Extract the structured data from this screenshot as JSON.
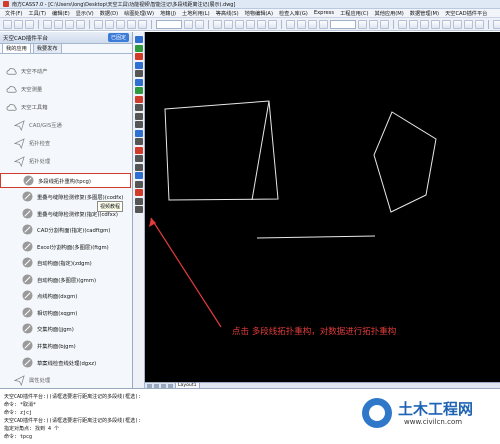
{
  "window": {
    "title": "南方CASS7.0 - [C:\\Users\\long\\Desktop\\天空工具\\功能视频\\智能注记\\多段线距离注记(展示).dwg]"
  },
  "menu": [
    "文件(F)",
    "工具(T)",
    "编辑(E)",
    "显示(V)",
    "数据(D)",
    "绘图处理(W)",
    "地籍(J)",
    "土地利用(L)",
    "等高线(S)",
    "地物编辑(A)",
    "检查入库(G)",
    "Express",
    "工程应用(C)",
    "其他应用(M)",
    "数据管理(M)",
    "天空CAD插件平台"
  ],
  "panel": {
    "title": "天空CAD插件平台",
    "pin_label": "已固定",
    "tabs": [
      "我的应用",
      "我要发布"
    ],
    "items": [
      {
        "label": "天空不动产",
        "kind": "group"
      },
      {
        "label": "天空测量",
        "kind": "group"
      },
      {
        "label": "天空工具箱",
        "kind": "group"
      },
      {
        "label": "CAD/GIS互通",
        "kind": "sub"
      },
      {
        "label": "拓扑检查",
        "kind": "sub"
      },
      {
        "label": "拓扑处理",
        "kind": "sub"
      },
      {
        "label": "多段线拓扑重构(tpcg)",
        "kind": "tool",
        "selected": true
      },
      {
        "label": "重叠与缝隙检测修复(多图层)(codfx)",
        "kind": "tool"
      },
      {
        "label": "重叠与缝隙检测修复(指定)(cdfxx)",
        "kind": "tool"
      },
      {
        "label": "CAD分割构面(指定)(cadftgm)",
        "kind": "tool"
      },
      {
        "label": "Excel分割构面(多图层)(ftgm)",
        "kind": "tool"
      },
      {
        "label": "自动构面(指定)(zdgm)",
        "kind": "tool"
      },
      {
        "label": "自动构面(多图层)(gmm)",
        "kind": "tool"
      },
      {
        "label": "点线构面(dxgm)",
        "kind": "tool"
      },
      {
        "label": "相切构面(xqgm)",
        "kind": "tool"
      },
      {
        "label": "交集构面(jjgm)",
        "kind": "tool"
      },
      {
        "label": "并集构面(bjgm)",
        "kind": "tool"
      },
      {
        "label": "草案线检查线处理(dgxz)",
        "kind": "tool"
      },
      {
        "label": "属性处理",
        "kind": "sub"
      }
    ],
    "tooltip": "视频教程"
  },
  "canvas": {
    "annotation": "点击 多段线拓扑重构，对数据进行拓扑重构",
    "line_color": "#e8e8e8",
    "arrow_color": "#e23b3b"
  },
  "layout_tabs": [
    "Layout1"
  ],
  "command_lines": [
    "天空CAD插件平台:))请框选要进行距离注记的多段线(框选):",
    "命令: *取消*",
    "命令: zjcj",
    "天空CAD插件平台:))请框选要进行距离注记的多段线(框选):",
    "指定对角点: 找到 4 个",
    "命令: tpcg"
  ],
  "watermark": {
    "title": "土木工程网",
    "url": "www.civilcn.com"
  }
}
